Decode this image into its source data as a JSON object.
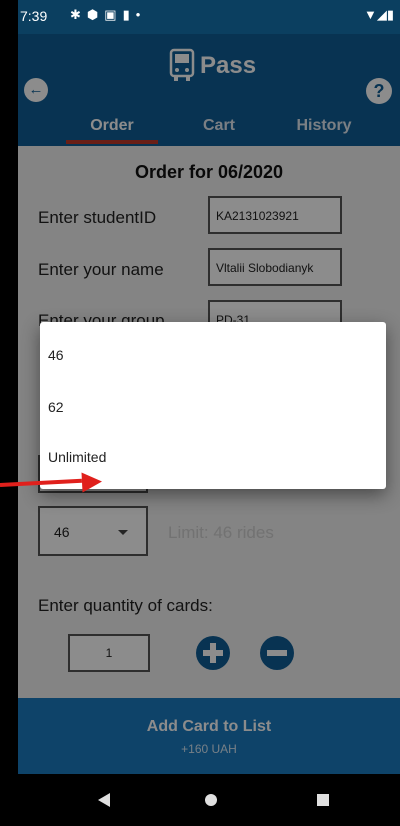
{
  "status_bar": {
    "time": "7:39",
    "left_icons": [
      "settings-icon",
      "shield-icon",
      "image-icon",
      "sd-card-icon",
      "dot-icon"
    ],
    "right_icons": [
      "wifi-icon",
      "signal-icon",
      "battery-icon"
    ]
  },
  "app_bar": {
    "title": "Pass",
    "tabs": [
      {
        "label": "Order",
        "active": true
      },
      {
        "label": "Cart",
        "active": false
      },
      {
        "label": "History",
        "active": false
      }
    ]
  },
  "form": {
    "order_title": "Order for 06/2020",
    "student_id_label": "Enter studentID",
    "student_id_value": "KA2131023921",
    "name_label": "Enter your name",
    "name_value": "Vltalii Slobodianyk",
    "group_label": "Enter your group",
    "group_value": "PD-31",
    "rides_value": "46",
    "limit_text": "Limit: 46 rides",
    "quantity_label": "Enter quantity of cards:",
    "quantity_value": "1"
  },
  "dropdown": {
    "options": [
      "46",
      "62",
      "Unlimited"
    ]
  },
  "add_card": {
    "title": "Add Card to List",
    "price": "+160 UAH"
  },
  "colors": {
    "primary": "#105e96",
    "accent_button": "#1a7ac0",
    "tab_indicator": "#c0392b",
    "annotation_arrow": "#e0201c"
  }
}
